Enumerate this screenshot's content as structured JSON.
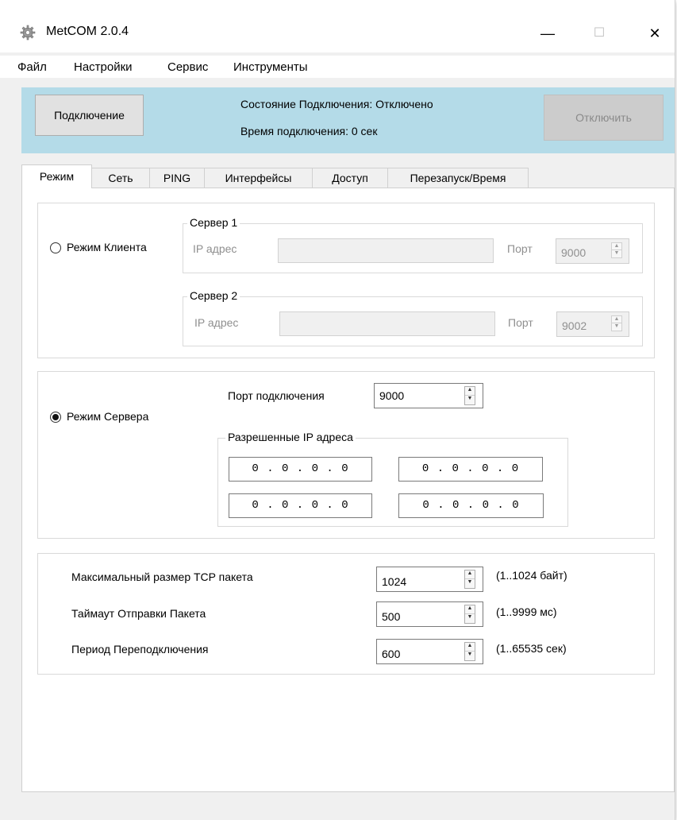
{
  "window": {
    "title": "MetCOM 2.0.4",
    "controls": {
      "minimize": "—",
      "maximize": "☐",
      "close": "✕"
    }
  },
  "menu": [
    "Файл",
    "Настройки",
    "Сервис",
    "Инструменты"
  ],
  "header": {
    "connect_button": "Подключение",
    "status_label": "Состояние Подключения: Отключено",
    "time_label": "Время подключения: 0 сек",
    "disconnect_button": "Отключить",
    "background_color": "#b4dbe8"
  },
  "tabs": [
    {
      "label": "Режим",
      "active": true
    },
    {
      "label": "Сеть",
      "active": false
    },
    {
      "label": "PING",
      "active": false
    },
    {
      "label": "Интерфейсы",
      "active": false
    },
    {
      "label": "Доступ",
      "active": false
    },
    {
      "label": "Перезапуск/Время",
      "active": false
    }
  ],
  "client_mode": {
    "label": "Режим Клиента",
    "selected": false,
    "server1": {
      "legend": "Сервер 1",
      "ip_label": "IP адрес",
      "ip_value": "",
      "port_label": "Порт",
      "port_value": "9000"
    },
    "server2": {
      "legend": "Сервер 2",
      "ip_label": "IP адрес",
      "ip_value": "",
      "port_label": "Порт",
      "port_value": "9002"
    }
  },
  "server_mode": {
    "label": "Режим Сервера",
    "selected": true,
    "port_label": "Порт подключения",
    "port_value": "9000",
    "allowed_legend": "Разрешенные IP адреса",
    "allowed_ips": [
      "0 . 0 . 0 . 0",
      "0 . 0 . 0 . 0",
      "0 . 0 . 0 . 0",
      "0 . 0 . 0 . 0"
    ]
  },
  "settings": [
    {
      "label": "Максимальный размер TCP пакета",
      "value": "1024",
      "range": "(1..1024 байт)"
    },
    {
      "label": "Таймаут Отправки Пакета",
      "value": "500",
      "range": "(1..9999 мс)"
    },
    {
      "label": "Период Переподключения",
      "value": "600",
      "range": "(1..65535 сек)"
    }
  ]
}
